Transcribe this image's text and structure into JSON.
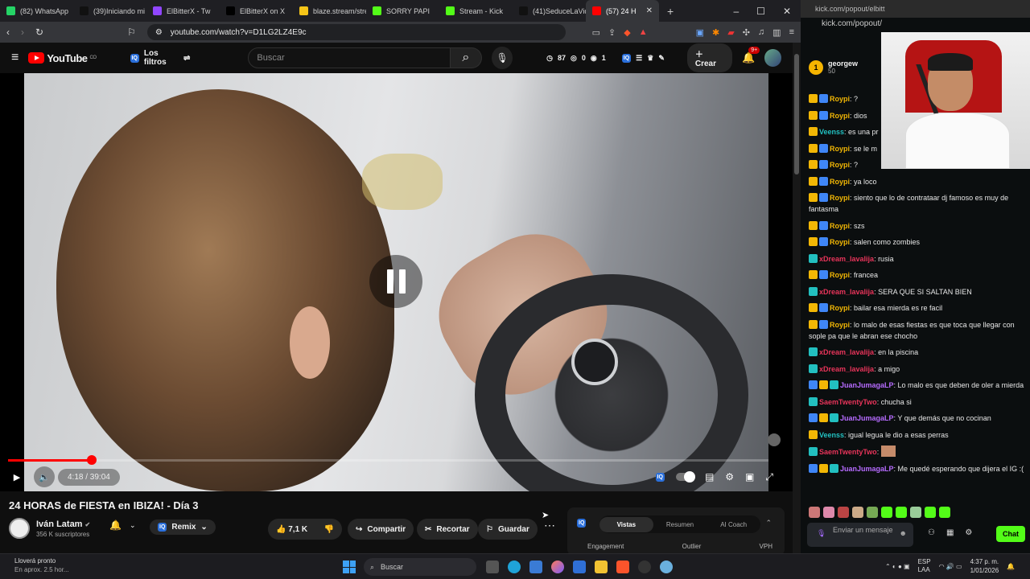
{
  "browser": {
    "tabs": [
      {
        "label": "(82) WhatsApp",
        "color": "#25d366"
      },
      {
        "label": "(39)Iniciando mi",
        "color": "#111111"
      },
      {
        "label": "ElBitterX - Tw",
        "color": "#9146ff"
      },
      {
        "label": "ElBitterX on X",
        "color": "#000000"
      },
      {
        "label": "blaze.stream/stre",
        "color": "#f5c518"
      },
      {
        "label": "SORRY PAPI",
        "color": "#53fc18"
      },
      {
        "label": "Stream - Kick",
        "color": "#53fc18"
      },
      {
        "label": "(41)SeduceLaVid",
        "color": "#111111"
      },
      {
        "label": "(57) 24 H",
        "color": "#ff0000",
        "active": true
      }
    ],
    "new_tab": "+",
    "url": "youtube.com/watch?v=D1LG2LZ4E9c",
    "window_controls": [
      "–",
      "☐",
      "✕"
    ]
  },
  "youtube": {
    "logo": "YouTube",
    "logo_region": "CO",
    "filters_label": "Los filtros",
    "search_placeholder": "Buscar",
    "stats": {
      "a": "87",
      "b": "0",
      "c": "1"
    },
    "create_label": "Crear",
    "notif_badge": "9+",
    "player": {
      "time": "4:18 / 39:04",
      "progress_fraction": 0.11
    },
    "video_title": "24 HORAS de FIESTA en IBIZA! - Día 3",
    "channel": {
      "name": "Iván Latam",
      "subs": "356 K suscriptores"
    },
    "remix_label": "Remix",
    "likes": "7,1 K",
    "actions": {
      "share": "Compartir",
      "clip": "Recortar",
      "save": "Guardar"
    },
    "iq_tabs": [
      "Vistas",
      "Resumen",
      "AI Coach"
    ],
    "iq_metrics": [
      "Engagement",
      "Outlier",
      "VPH"
    ]
  },
  "kick": {
    "url": "kick.com/popout/elbitt",
    "url2": "kick.com/popout/",
    "pinned": {
      "user": "georgew",
      "amount": "50"
    },
    "messages": [
      {
        "badges": [
          "crown",
          "vip"
        ],
        "user": "Roypi",
        "color": "#f2b705",
        "text": ": ?"
      },
      {
        "badges": [
          "crown",
          "vip"
        ],
        "user": "Roypi",
        "color": "#f2b705",
        "text": ": dios"
      },
      {
        "badges": [
          "crown"
        ],
        "user": "Veenss",
        "color": "#22c0c0",
        "text": ": es una pr"
      },
      {
        "badges": [
          "crown",
          "vip"
        ],
        "user": "Roypi",
        "color": "#f2b705",
        "text": ": se le m"
      },
      {
        "badges": [
          "crown",
          "vip"
        ],
        "user": "Roypi",
        "color": "#f2b705",
        "text": ": ?"
      },
      {
        "badges": [
          "crown",
          "vip"
        ],
        "user": "Roypi",
        "color": "#f2b705",
        "text": ": ya loco"
      },
      {
        "badges": [
          "crown",
          "vip"
        ],
        "user": "Roypi",
        "color": "#f2b705",
        "text": ": siento que lo de contrataar dj famoso es muy de fantasma"
      },
      {
        "badges": [
          "crown",
          "vip"
        ],
        "user": "Roypi",
        "color": "#f2b705",
        "text": ": szs"
      },
      {
        "badges": [
          "crown",
          "vip"
        ],
        "user": "Roypi",
        "color": "#f2b705",
        "text": ": salen como zombies"
      },
      {
        "badges": [
          "sub"
        ],
        "user": "xDream_lavalija",
        "color": "#e8345a",
        "text": ": rusia"
      },
      {
        "badges": [
          "crown",
          "vip"
        ],
        "user": "Roypi",
        "color": "#f2b705",
        "text": ": francea"
      },
      {
        "badges": [
          "sub"
        ],
        "user": "xDream_lavalija",
        "color": "#e8345a",
        "text": ": SERA QUE SI SALTAN BIEN"
      },
      {
        "badges": [
          "crown",
          "vip"
        ],
        "user": "Roypi",
        "color": "#f2b705",
        "text": ": bailar esa mierda es re facil"
      },
      {
        "badges": [
          "crown",
          "vip"
        ],
        "user": "Roypi",
        "color": "#f2b705",
        "text": ": lo malo de esas fiestas es que toca que llegar con sople pa que le abran ese chocho"
      },
      {
        "badges": [
          "sub"
        ],
        "user": "xDream_lavalija",
        "color": "#e8345a",
        "text": ": en la piscina"
      },
      {
        "badges": [
          "sub"
        ],
        "user": "xDream_lavalija",
        "color": "#e8345a",
        "text": ": a migo"
      },
      {
        "badges": [
          "vip",
          "crown",
          "sub"
        ],
        "user": "JuanJumagaLP",
        "color": "#b66bff",
        "text": ": Lo malo es que deben de oler a mierda"
      },
      {
        "badges": [
          "sub"
        ],
        "user": "SaemTwentyTwo",
        "color": "#e8345a",
        "text": ": chucha si"
      },
      {
        "badges": [
          "vip",
          "crown",
          "sub"
        ],
        "user": "JuanJumagaLP",
        "color": "#b66bff",
        "text": ": Y que demás que no cocinan"
      },
      {
        "badges": [
          "crown"
        ],
        "user": "Veenss",
        "color": "#22c0c0",
        "text": ": igual legua le dio a esas perras"
      },
      {
        "badges": [
          "sub"
        ],
        "user": "SaemTwentyTwo",
        "color": "#e8345a",
        "text": ":"
      },
      {
        "badges": [
          "vip",
          "crown",
          "sub"
        ],
        "user": "JuanJumagaLP",
        "color": "#b66bff",
        "text": ": Me quedé esperando que dijera el IG :("
      }
    ],
    "input_placeholder": "Enviar un mensaje",
    "chat_button": "Chat"
  },
  "taskbar": {
    "weather_title": "Lloverá pronto",
    "weather_sub": "En aprox. 2.5 hor...",
    "search_label": "Buscar",
    "lang": "ESP",
    "lang2": "LAA",
    "time": "4:37 p. m.",
    "date": "1/01/2026"
  }
}
